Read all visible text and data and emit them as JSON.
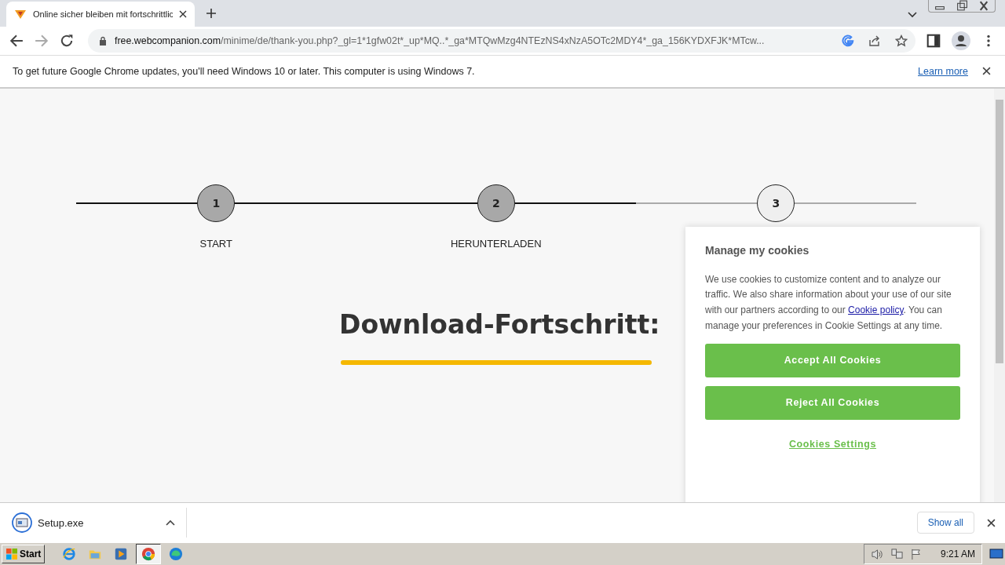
{
  "browser": {
    "tab_title": "Online sicher bleiben mit fortschrittlic",
    "url_host": "free.webcompanion.com",
    "url_path": "/minime/de/thank-you.php?_gl=1*1gfw02t*_up*MQ..*_ga*MTQwMzg4NTEzNS4xNzA5OTc2MDY4*_ga_156KYDXFJK*MTcw..."
  },
  "infobar": {
    "message": "To get future Google Chrome updates, you'll need Windows 10 or later. This computer is using Windows 7.",
    "link": "Learn more"
  },
  "steps": [
    {
      "number": "1",
      "label": "START",
      "done": true
    },
    {
      "number": "2",
      "label": "HERUNTERLADEN",
      "done": true
    },
    {
      "number": "3",
      "done": false
    }
  ],
  "progress": {
    "title": "Download-Fortschritt:",
    "level": 1
  },
  "cookie_panel": {
    "title": "Manage my cookies",
    "text_before": "We use cookies to customize content and to analyze our traffic. We also share information about your use of our site with our partners according to our ",
    "link": "Cookie policy",
    "text_after": ". You can manage your preferences in Cookie Settings at any time.",
    "buttons": [
      "Accept All Cookies",
      "Reject All Cookies"
    ],
    "settings_link": "Cookies Settings"
  },
  "downloads": {
    "file": "Setup.exe",
    "show_all": "Show all"
  },
  "taskbar": {
    "start": "Start",
    "apps": [
      {
        "kind": "ie",
        "selected": false
      },
      {
        "kind": "folder",
        "selected": false
      },
      {
        "kind": "media",
        "selected": false
      },
      {
        "kind": "chrome",
        "selected": true
      },
      {
        "kind": "edge",
        "selected": false
      }
    ],
    "time": "9:21 AM"
  }
}
